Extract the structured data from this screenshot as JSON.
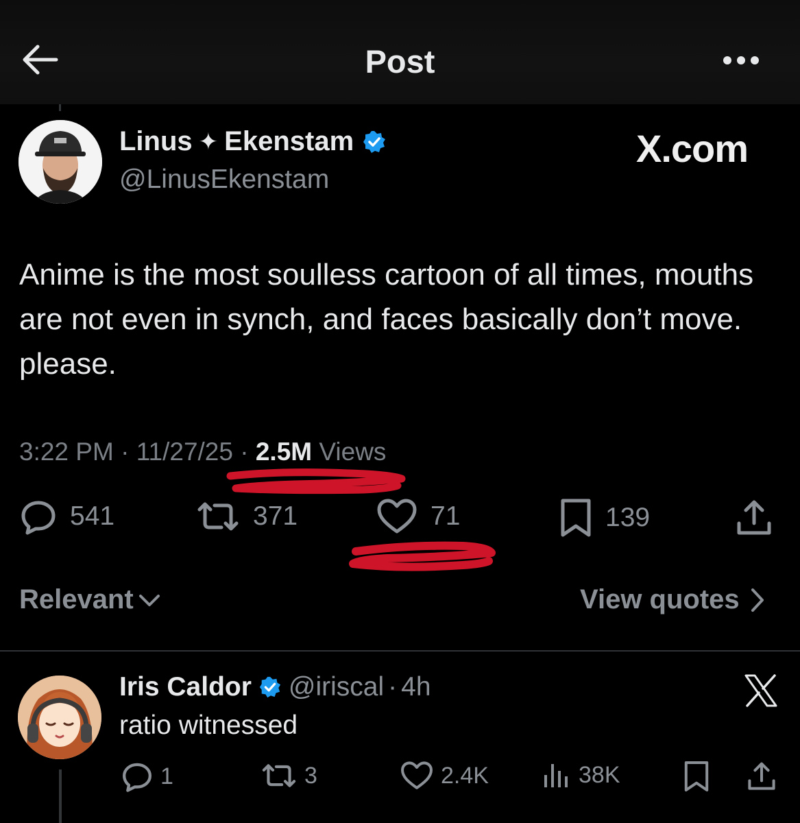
{
  "header": {
    "title": "Post"
  },
  "post": {
    "author_name_first": "Linus",
    "author_name_sep": "✦",
    "author_name_last": "Ekenstam",
    "handle": "@LinusEkenstam",
    "watermark": "X.com",
    "text": "Anime is the most soulless cartoon of all times, mouths are not even in synch, and faces basically don’t move. please.",
    "time": "3:22 PM",
    "date": "11/27/25",
    "views_count": "2.5M",
    "views_label": "Views",
    "separator": "·",
    "stats": {
      "replies": "541",
      "reposts": "371",
      "likes": "71",
      "bookmarks": "139"
    }
  },
  "sort": {
    "label": "Relevant",
    "view_quotes": "View quotes"
  },
  "reply": {
    "author_name": "Iris Caldor",
    "handle": "@iriscal",
    "age": "4h",
    "separator": "·",
    "text": "ratio witnessed",
    "stats": {
      "replies": "1",
      "reposts": "3",
      "likes": "2.4K",
      "views": "38K"
    }
  },
  "colors": {
    "background": "#000000",
    "verified": "#1d9bf0",
    "muted": "#8b9096",
    "text": "#e7e9ea",
    "scribble": "#e0162b"
  },
  "icons": [
    "back-arrow-icon",
    "more-icon",
    "verified-badge-icon",
    "reply-icon",
    "repost-icon",
    "like-icon",
    "bookmark-icon",
    "share-icon",
    "chevron-down-icon",
    "chevron-right-icon",
    "x-logo-icon",
    "views-icon"
  ]
}
